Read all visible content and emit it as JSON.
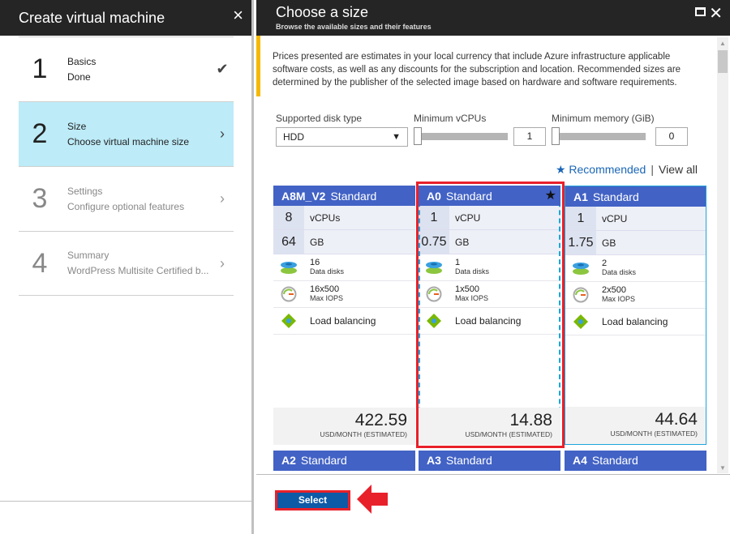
{
  "left_panel": {
    "title": "Create virtual machine",
    "close_icon": "×",
    "steps": [
      {
        "number": "1",
        "title": "Basics",
        "subtitle": "Done",
        "status": "done"
      },
      {
        "number": "2",
        "title": "Size",
        "subtitle": "Choose virtual machine size",
        "status": "active"
      },
      {
        "number": "3",
        "title": "Settings",
        "subtitle": "Configure optional features",
        "status": "pending"
      },
      {
        "number": "4",
        "title": "Summary",
        "subtitle": "WordPress Multisite Certified b...",
        "status": "pending"
      }
    ]
  },
  "right_panel": {
    "title": "Choose a size",
    "subtitle": "Browse the available sizes and their features",
    "notice": "Prices presented are estimates in your local currency that include Azure infrastructure applicable software costs, as well as any discounts for the subscription and location. Recommended sizes are determined by the publisher of the selected image based on hardware and software requirements.",
    "filters": {
      "disk_type_label": "Supported disk type",
      "disk_type_value": "HDD",
      "min_vcpus_label": "Minimum vCPUs",
      "min_vcpus_value": "1",
      "min_memory_label": "Minimum memory (GiB)",
      "min_memory_value": "0"
    },
    "view_toggle": {
      "recommended": "★ Recommended",
      "separator": "|",
      "view_all": "View all"
    },
    "cards": [
      {
        "name": "A8M_V2",
        "tier": "Standard",
        "vcpus": "8",
        "vcpu_unit": "vCPUs",
        "memory": "64",
        "memory_unit": "GB",
        "data_disks": "16",
        "data_disks_label": "Data disks",
        "iops": "16x500",
        "iops_label": "Max IOPS",
        "feature": "Load balancing",
        "price": "422.59",
        "currency": "USD/MONTH (ESTIMATED)",
        "recommended": false
      },
      {
        "name": "A0",
        "tier": "Standard",
        "vcpus": "1",
        "vcpu_unit": "vCPU",
        "memory": "0.75",
        "memory_unit": "GB",
        "data_disks": "1",
        "data_disks_label": "Data disks",
        "iops": "1x500",
        "iops_label": "Max IOPS",
        "feature": "Load balancing",
        "price": "14.88",
        "currency": "USD/MONTH (ESTIMATED)",
        "recommended": true,
        "selected": true
      },
      {
        "name": "A1",
        "tier": "Standard",
        "vcpus": "1",
        "vcpu_unit": "vCPU",
        "memory": "1.75",
        "memory_unit": "GB",
        "data_disks": "2",
        "data_disks_label": "Data disks",
        "iops": "2x500",
        "iops_label": "Max IOPS",
        "feature": "Load balancing",
        "price": "44.64",
        "currency": "USD/MONTH (ESTIMATED)",
        "recommended": false
      }
    ],
    "next_row": [
      {
        "name": "A2",
        "tier": "Standard"
      },
      {
        "name": "A3",
        "tier": "Standard"
      },
      {
        "name": "A4",
        "tier": "Standard"
      }
    ],
    "select_button": "Select"
  }
}
